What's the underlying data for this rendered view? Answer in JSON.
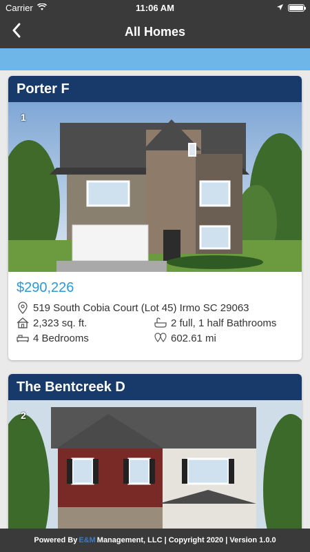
{
  "status": {
    "carrier": "Carrier",
    "time": "11:06 AM"
  },
  "nav": {
    "title": "All Homes",
    "back_icon": "chevron-left-icon"
  },
  "homes": [
    {
      "name": "Porter F",
      "index": "1",
      "price": "$290,226",
      "address": "519 South Cobia Court (Lot 45) Irmo SC 29063",
      "sqft": "2,323 sq. ft.",
      "bathrooms": "2 full, 1 half Bathrooms",
      "bedrooms": "4 Bedrooms",
      "distance": "602.61 mi"
    },
    {
      "name": "The Bentcreek D",
      "index": "2"
    }
  ],
  "footer": {
    "prefix": "Powered By",
    "brand": "E&M",
    "suffix": "Management, LLC | Copyright 2020 | Version 1.0.0"
  },
  "colors": {
    "header": "#3a3a3a",
    "card_header": "#173a6b",
    "accent": "#2b9ad6",
    "band": "#6fb6e8"
  }
}
